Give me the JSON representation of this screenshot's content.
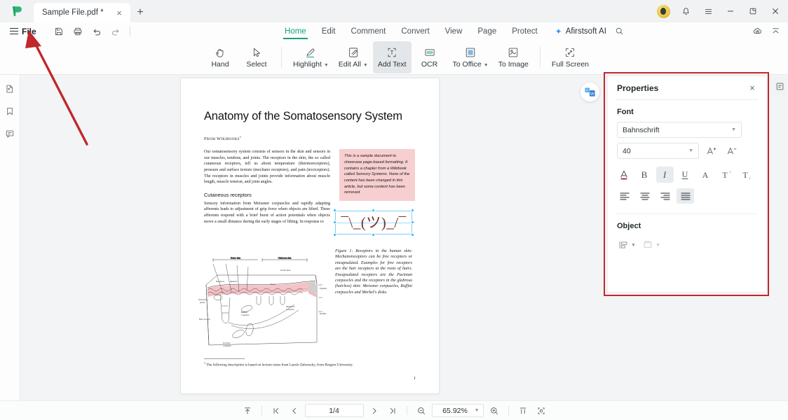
{
  "window": {
    "tab_title": "Sample File.pdf *",
    "new_tab_label": "+",
    "close_tab_label": "×",
    "minimize_label": "—",
    "close_label": "×"
  },
  "menubar": {
    "file_label": "File",
    "quick_actions": [
      "save-icon",
      "print-icon",
      "undo-icon",
      "redo-icon"
    ],
    "nav_items": [
      {
        "label": "Home",
        "active": true
      },
      {
        "label": "Edit",
        "active": false
      },
      {
        "label": "Comment",
        "active": false
      },
      {
        "label": "Convert",
        "active": false
      },
      {
        "label": "View",
        "active": false
      },
      {
        "label": "Page",
        "active": false
      },
      {
        "label": "Protect",
        "active": false
      }
    ],
    "ai_label": "Afirstsoft AI",
    "accent_color": "#17a07e"
  },
  "ribbon": {
    "buttons": [
      {
        "label": "Hand",
        "icon": "hand-icon",
        "caret": false,
        "active": false
      },
      {
        "label": "Select",
        "icon": "cursor-icon",
        "caret": false,
        "active": false
      },
      {
        "label": "Highlight",
        "icon": "highlight-icon",
        "caret": true,
        "active": false
      },
      {
        "label": "Edit All",
        "icon": "edit-all-icon",
        "caret": true,
        "active": false
      },
      {
        "label": "Add Text",
        "icon": "add-text-icon",
        "caret": false,
        "active": true
      },
      {
        "label": "OCR",
        "icon": "ocr-icon",
        "caret": false,
        "active": false
      },
      {
        "label": "To Office",
        "icon": "to-office-icon",
        "caret": true,
        "active": false
      },
      {
        "label": "To Image",
        "icon": "to-image-icon",
        "caret": false,
        "active": false
      },
      {
        "label": "Full Screen",
        "icon": "full-screen-icon",
        "caret": false,
        "active": false
      }
    ]
  },
  "left_rail": [
    {
      "name": "thumbnails-icon"
    },
    {
      "name": "bookmark-icon"
    },
    {
      "name": "comment-icon"
    }
  ],
  "document": {
    "title": "Anatomy of the Somatosensory System",
    "byline": "From Wikibooks",
    "byline_sup": "1",
    "paragraph1": "Our somatosensory system consists of sensors in the skin and sensors in our muscles, tendons, and joints. The receptors in the skin, the so called cutaneous receptors, tell us about temperature (thermoreceptors), pressure and surface texture (mechano receptors), and pain (nociceptors). The receptors in muscles and joints provide information about muscle length, muscle tension, and joint angles.",
    "callout": "This is a sample document to showcase page-based formatting. It contains a chapter from a Wikibook called Sensory Systems. None of the content has been changed in this article, but some content has been removed.",
    "subheading": "Cutaneous receptors",
    "paragraph2": "Sensory information from Meissner corpuscles and rapidly adapting afferents leads to adjustment of grip force when objects are lifted. These afferents respond with a brief burst of action potentials when objects move a small distance during the early stages of lifting. In response to",
    "figure_caption": "Figure 1: Receptors in the human skin: Mechanoreceptors can be free receptors or encapsulated. Examples for free receptors are the hair receptors at the roots of hairs. Encapsulated receptors are the Pacinian corpuscles and the receptors in the glabrous (hairless) skin: Meissner corpuscles, Ruffini corpuscles and Merkel's disks.",
    "footnote_sup": "1",
    "footnote": "The following description is based on lecture notes from Laszlo Zaborszky, from Rutgers University.",
    "page_number": "1",
    "selected_object_text": "¯\\_(ツ)_/¯"
  },
  "properties": {
    "title": "Properties",
    "close_label": "×",
    "font_section": "Font",
    "font_family_value": "Bahnschrift",
    "font_size_value": "40",
    "increase_size_icon": "increase-font-size-icon",
    "decrease_size_icon": "decrease-font-size-icon",
    "style_buttons": [
      {
        "name": "font-color-icon",
        "glyph": "A",
        "active": false
      },
      {
        "name": "bold-icon",
        "glyph": "B",
        "active": false
      },
      {
        "name": "italic-icon",
        "glyph": "I",
        "active": true
      },
      {
        "name": "underline-icon",
        "glyph": "U",
        "active": false
      },
      {
        "name": "strikethrough-icon",
        "glyph": "A",
        "active": false
      },
      {
        "name": "superscript-icon",
        "glyph": "T",
        "active": false
      },
      {
        "name": "subscript-icon",
        "glyph": "T",
        "active": false
      }
    ],
    "align_buttons": [
      {
        "name": "align-left-icon",
        "active": false
      },
      {
        "name": "align-center-icon",
        "active": false
      },
      {
        "name": "align-right-icon",
        "active": false
      },
      {
        "name": "align-justify-icon",
        "active": true
      }
    ],
    "object_section": "Object",
    "object_buttons": [
      "align-objects-icon",
      "arrange-objects-icon"
    ],
    "highlight_border_color": "#c0282c"
  },
  "statusbar": {
    "page_value": "1/4",
    "zoom_value": "65.92%",
    "buttons": [
      "scroll-to-top-icon",
      "first-page-icon",
      "previous-page-icon",
      "next-page-icon",
      "last-page-icon",
      "zoom-out-icon",
      "zoom-in-icon",
      "fit-width-icon",
      "fit-page-icon"
    ]
  },
  "annotations": {
    "arrow_color": "#c0282c",
    "arrow_target": "file-menu"
  }
}
